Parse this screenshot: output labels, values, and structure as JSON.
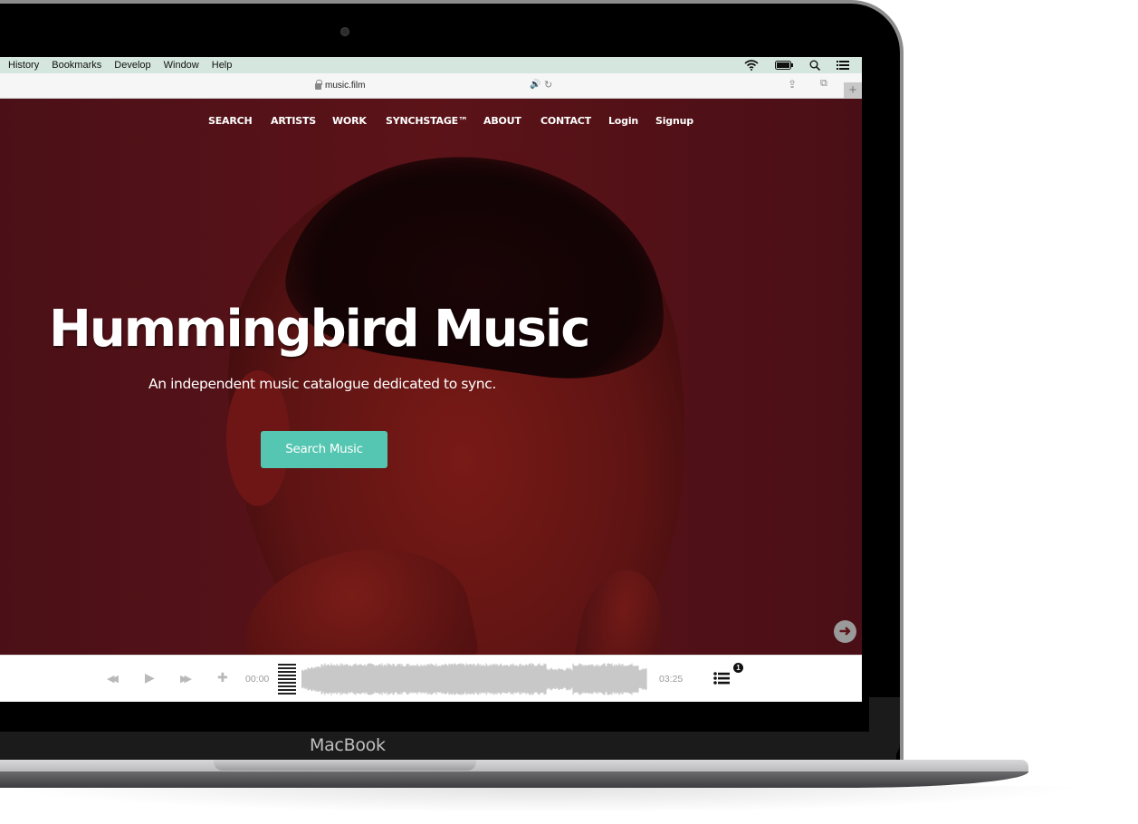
{
  "device": {
    "brand_label": "MacBook"
  },
  "menubar": {
    "items": [
      "History",
      "Bookmarks",
      "Develop",
      "Window",
      "Help"
    ],
    "status_icons": [
      "wifi-icon",
      "battery-icon",
      "spotlight-search-icon",
      "notification-center-icon"
    ]
  },
  "browser": {
    "url": "music.film",
    "audio_icon": "🔊",
    "reload_icon": "↻",
    "share_icon": "⇪",
    "tabs_icon": "⧉",
    "new_tab_label": "+"
  },
  "site": {
    "nav": [
      {
        "label": "SEARCH"
      },
      {
        "label": "ARTISTS"
      },
      {
        "label": "WORK"
      },
      {
        "label": "SYNCHSTAGE™"
      },
      {
        "label": "ABOUT"
      },
      {
        "label": "CONTACT"
      },
      {
        "label": "Login"
      },
      {
        "label": "Signup"
      }
    ],
    "hero": {
      "title": "Hummingbird Music",
      "subtitle": "An independent music catalogue dedicated to sync.",
      "cta_label": "Search Music",
      "next_icon": "➜"
    },
    "colors": {
      "accent": "#55c6b1",
      "hero_overlay": "#5b1318",
      "menubar_bg": "#d5e6df"
    }
  },
  "player": {
    "rewind_icon": "◀◀",
    "play_icon": "▶",
    "forward_icon": "▶▶",
    "add_icon": "✚",
    "current_time": "00:00",
    "duration": "03:25",
    "progress": 0,
    "queue_count": "1"
  }
}
